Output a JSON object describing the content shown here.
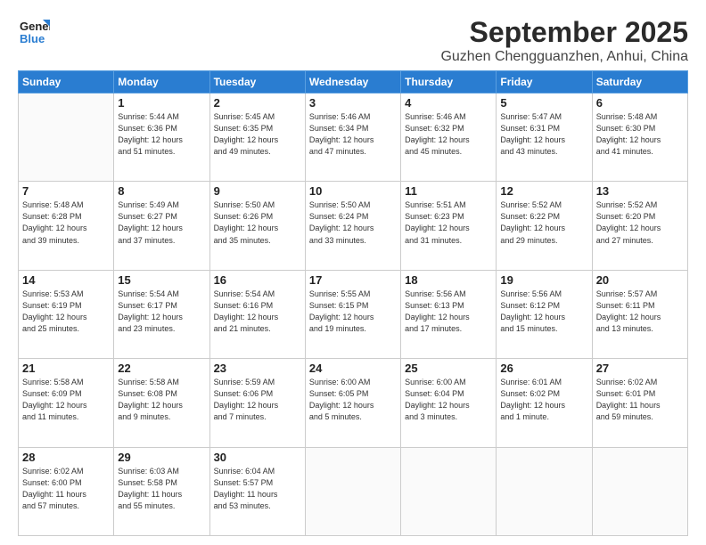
{
  "header": {
    "logo_line1": "General",
    "logo_line2": "Blue",
    "month": "September 2025",
    "location": "Guzhen Chengguanzhen, Anhui, China"
  },
  "weekdays": [
    "Sunday",
    "Monday",
    "Tuesday",
    "Wednesday",
    "Thursday",
    "Friday",
    "Saturday"
  ],
  "weeks": [
    [
      {
        "day": "",
        "info": ""
      },
      {
        "day": "1",
        "info": "Sunrise: 5:44 AM\nSunset: 6:36 PM\nDaylight: 12 hours\nand 51 minutes."
      },
      {
        "day": "2",
        "info": "Sunrise: 5:45 AM\nSunset: 6:35 PM\nDaylight: 12 hours\nand 49 minutes."
      },
      {
        "day": "3",
        "info": "Sunrise: 5:46 AM\nSunset: 6:34 PM\nDaylight: 12 hours\nand 47 minutes."
      },
      {
        "day": "4",
        "info": "Sunrise: 5:46 AM\nSunset: 6:32 PM\nDaylight: 12 hours\nand 45 minutes."
      },
      {
        "day": "5",
        "info": "Sunrise: 5:47 AM\nSunset: 6:31 PM\nDaylight: 12 hours\nand 43 minutes."
      },
      {
        "day": "6",
        "info": "Sunrise: 5:48 AM\nSunset: 6:30 PM\nDaylight: 12 hours\nand 41 minutes."
      }
    ],
    [
      {
        "day": "7",
        "info": "Sunrise: 5:48 AM\nSunset: 6:28 PM\nDaylight: 12 hours\nand 39 minutes."
      },
      {
        "day": "8",
        "info": "Sunrise: 5:49 AM\nSunset: 6:27 PM\nDaylight: 12 hours\nand 37 minutes."
      },
      {
        "day": "9",
        "info": "Sunrise: 5:50 AM\nSunset: 6:26 PM\nDaylight: 12 hours\nand 35 minutes."
      },
      {
        "day": "10",
        "info": "Sunrise: 5:50 AM\nSunset: 6:24 PM\nDaylight: 12 hours\nand 33 minutes."
      },
      {
        "day": "11",
        "info": "Sunrise: 5:51 AM\nSunset: 6:23 PM\nDaylight: 12 hours\nand 31 minutes."
      },
      {
        "day": "12",
        "info": "Sunrise: 5:52 AM\nSunset: 6:22 PM\nDaylight: 12 hours\nand 29 minutes."
      },
      {
        "day": "13",
        "info": "Sunrise: 5:52 AM\nSunset: 6:20 PM\nDaylight: 12 hours\nand 27 minutes."
      }
    ],
    [
      {
        "day": "14",
        "info": "Sunrise: 5:53 AM\nSunset: 6:19 PM\nDaylight: 12 hours\nand 25 minutes."
      },
      {
        "day": "15",
        "info": "Sunrise: 5:54 AM\nSunset: 6:17 PM\nDaylight: 12 hours\nand 23 minutes."
      },
      {
        "day": "16",
        "info": "Sunrise: 5:54 AM\nSunset: 6:16 PM\nDaylight: 12 hours\nand 21 minutes."
      },
      {
        "day": "17",
        "info": "Sunrise: 5:55 AM\nSunset: 6:15 PM\nDaylight: 12 hours\nand 19 minutes."
      },
      {
        "day": "18",
        "info": "Sunrise: 5:56 AM\nSunset: 6:13 PM\nDaylight: 12 hours\nand 17 minutes."
      },
      {
        "day": "19",
        "info": "Sunrise: 5:56 AM\nSunset: 6:12 PM\nDaylight: 12 hours\nand 15 minutes."
      },
      {
        "day": "20",
        "info": "Sunrise: 5:57 AM\nSunset: 6:11 PM\nDaylight: 12 hours\nand 13 minutes."
      }
    ],
    [
      {
        "day": "21",
        "info": "Sunrise: 5:58 AM\nSunset: 6:09 PM\nDaylight: 12 hours\nand 11 minutes."
      },
      {
        "day": "22",
        "info": "Sunrise: 5:58 AM\nSunset: 6:08 PM\nDaylight: 12 hours\nand 9 minutes."
      },
      {
        "day": "23",
        "info": "Sunrise: 5:59 AM\nSunset: 6:06 PM\nDaylight: 12 hours\nand 7 minutes."
      },
      {
        "day": "24",
        "info": "Sunrise: 6:00 AM\nSunset: 6:05 PM\nDaylight: 12 hours\nand 5 minutes."
      },
      {
        "day": "25",
        "info": "Sunrise: 6:00 AM\nSunset: 6:04 PM\nDaylight: 12 hours\nand 3 minutes."
      },
      {
        "day": "26",
        "info": "Sunrise: 6:01 AM\nSunset: 6:02 PM\nDaylight: 12 hours\nand 1 minute."
      },
      {
        "day": "27",
        "info": "Sunrise: 6:02 AM\nSunset: 6:01 PM\nDaylight: 11 hours\nand 59 minutes."
      }
    ],
    [
      {
        "day": "28",
        "info": "Sunrise: 6:02 AM\nSunset: 6:00 PM\nDaylight: 11 hours\nand 57 minutes."
      },
      {
        "day": "29",
        "info": "Sunrise: 6:03 AM\nSunset: 5:58 PM\nDaylight: 11 hours\nand 55 minutes."
      },
      {
        "day": "30",
        "info": "Sunrise: 6:04 AM\nSunset: 5:57 PM\nDaylight: 11 hours\nand 53 minutes."
      },
      {
        "day": "",
        "info": ""
      },
      {
        "day": "",
        "info": ""
      },
      {
        "day": "",
        "info": ""
      },
      {
        "day": "",
        "info": ""
      }
    ]
  ]
}
